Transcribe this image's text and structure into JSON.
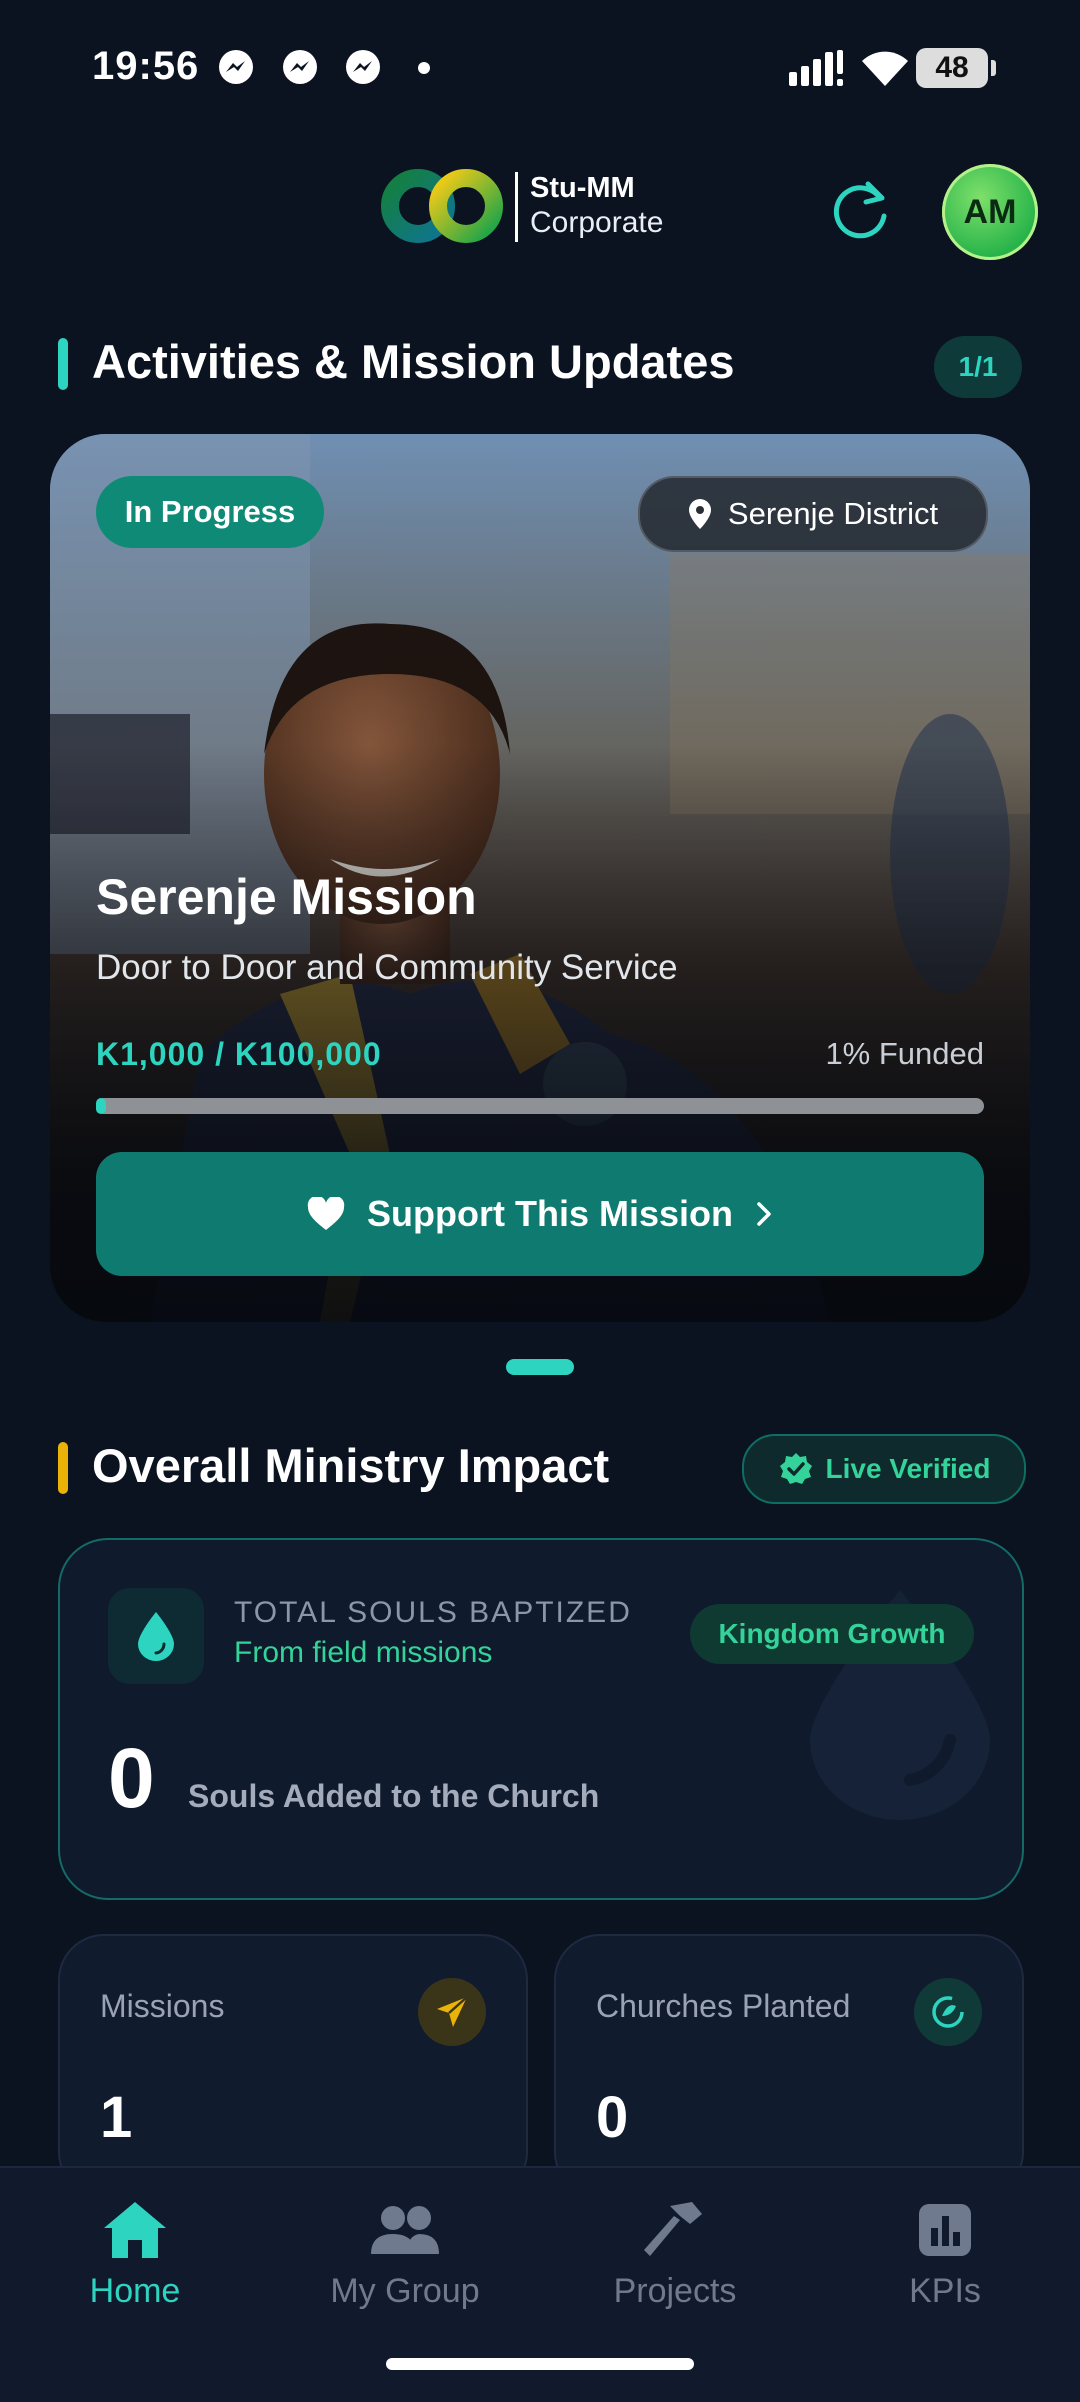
{
  "status_bar": {
    "time": "19:56",
    "battery": "48"
  },
  "header": {
    "brand_line1": "Stu-MM",
    "brand_line2": "Corporate",
    "avatar_initials": "AM"
  },
  "activities": {
    "title": "Activities & Mission Updates",
    "pager": "1/1",
    "card": {
      "status": "In Progress",
      "location": "Serenje District",
      "title": "Serenje Mission",
      "subtitle": "Door to Door and Community Service",
      "amount": "K1,000 / K100,000",
      "funded": "1% Funded",
      "progress_fraction": 0.01,
      "cta": "Support This Mission"
    }
  },
  "impact": {
    "title": "Overall Ministry Impact",
    "verified": "Live Verified",
    "card": {
      "label": "TOTAL SOULS BAPTIZED",
      "sublabel": "From field missions",
      "tag": "Kingdom Growth",
      "value": "0",
      "value_label": "Souls Added to the Church"
    },
    "stats": [
      {
        "label": "Missions",
        "value": "1",
        "icon": "paper-plane-icon"
      },
      {
        "label": "Churches Planted",
        "value": "0",
        "icon": "church-icon"
      }
    ]
  },
  "nav": [
    {
      "label": "Home",
      "icon": "home-icon",
      "active": true
    },
    {
      "label": "My Group",
      "icon": "group-icon",
      "active": false
    },
    {
      "label": "Projects",
      "icon": "hammer-icon",
      "active": false
    },
    {
      "label": "KPIs",
      "icon": "chart-icon",
      "active": false
    }
  ],
  "colors": {
    "accent": "#2dd4bf",
    "background": "#0b1220",
    "gold": "#eab308",
    "green": "#34d399"
  }
}
